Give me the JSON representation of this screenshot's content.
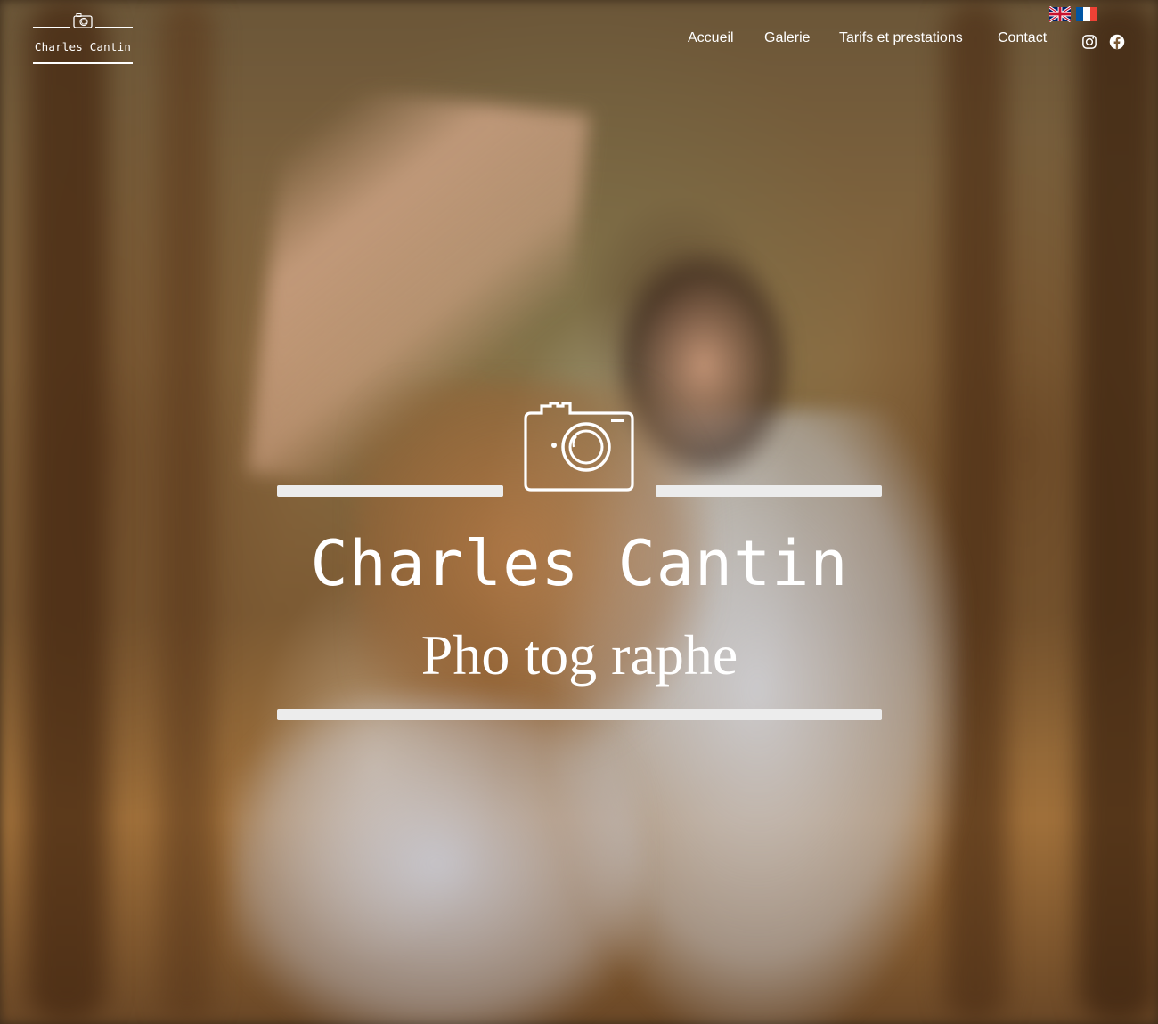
{
  "header": {
    "logo_text": "Charles Cantin",
    "nav": [
      {
        "label": "Accueil"
      },
      {
        "label": "Galerie"
      },
      {
        "label": "Tarifs et prestations"
      },
      {
        "label": "Contact"
      }
    ],
    "languages": [
      "english-flag-icon",
      "french-flag-icon"
    ],
    "social": [
      "instagram-icon",
      "facebook-icon"
    ]
  },
  "hero": {
    "name": "Charles Cantin",
    "subtitle": "Pho tog raphe",
    "icon": "camera-icon"
  },
  "colors": {
    "text": "#ffffff",
    "bar": "#ececec",
    "uk_blue": "#012169",
    "uk_red": "#C8102E",
    "fr_blue": "#0055A4",
    "fr_red": "#EF4135"
  }
}
